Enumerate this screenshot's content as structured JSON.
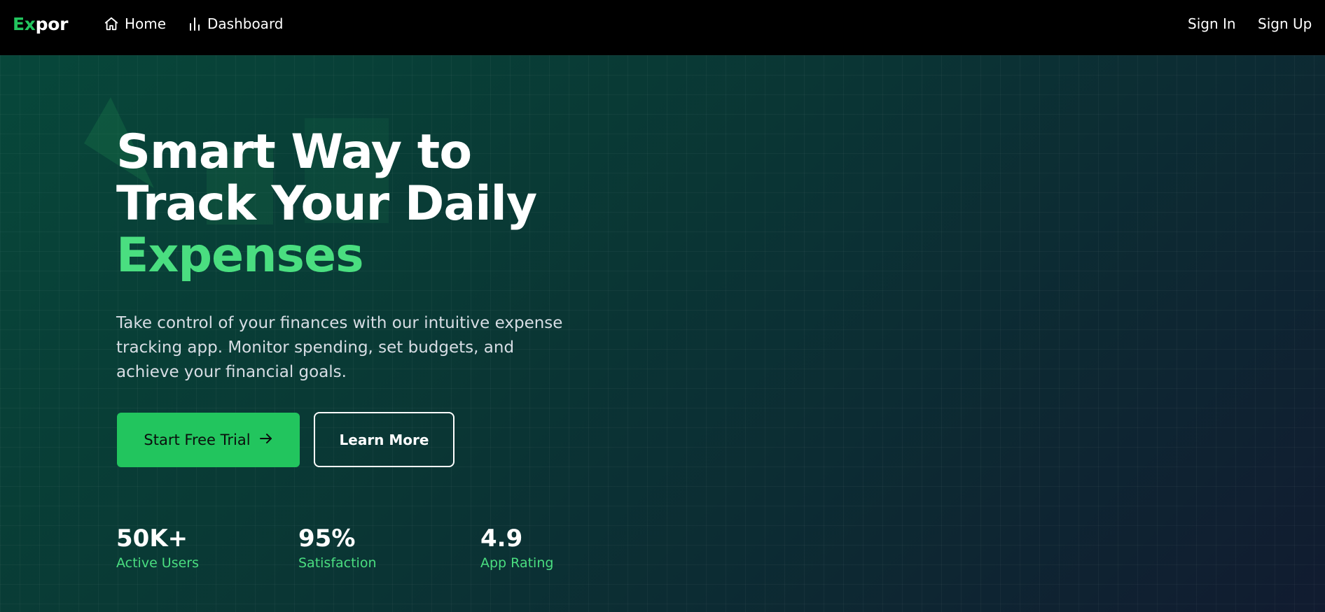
{
  "nav": {
    "logo_ex": "Ex",
    "logo_por": "por",
    "home_label": "Home",
    "dashboard_label": "Dashboard",
    "signin_label": "Sign In",
    "signup_label": "Sign Up",
    "icons": {
      "home": "home-icon",
      "dashboard": "bar-chart-icon"
    }
  },
  "hero": {
    "headline_line1": "Smart Way to",
    "headline_line2": "Track Your Daily",
    "headline_accent": "Expenses",
    "description": "Take control of your finances with our intuitive expense tracking app. Monitor spending, set budgets, and achieve your financial goals.",
    "primary_cta": "Start Free Trial",
    "secondary_cta": "Learn More",
    "primary_cta_icon": "arrow-right-icon"
  },
  "stats": [
    {
      "value": "50K+",
      "label": "Active Users"
    },
    {
      "value": "95%",
      "label": "Satisfaction"
    },
    {
      "value": "4.9",
      "label": "App Rating"
    }
  ],
  "colors": {
    "accent": "#22c55e",
    "accent_text": "#4ade80",
    "nav_background": "#000000",
    "hero_gradient_start": "#07473a",
    "hero_gradient_end": "#111b30"
  }
}
